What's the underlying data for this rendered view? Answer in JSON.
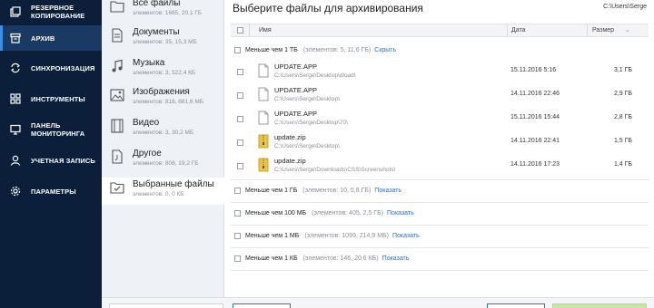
{
  "nav": {
    "items": [
      {
        "label": "РЕЗЕРВНОЕ КОПИРОВАНИЕ",
        "icon": "backup-icon"
      },
      {
        "label": "АРХИВ",
        "icon": "archive-icon",
        "active": true
      },
      {
        "label": "СИНХРОНИЗАЦИЯ",
        "icon": "sync-icon"
      },
      {
        "label": "ИНСТРУМЕНТЫ",
        "icon": "tools-icon"
      },
      {
        "label": "ПАНЕЛЬ МОНИТОРИНГА",
        "icon": "dashboard-icon"
      },
      {
        "label": "УЧЕТНАЯ ЗАПИСЬ",
        "icon": "account-icon"
      },
      {
        "label": "ПАРАМЕТРЫ",
        "icon": "settings-icon"
      }
    ]
  },
  "categories": [
    {
      "name": "Все файлы",
      "sub": "элементов: 1665, 20,1 ГБ",
      "icon": "folder-icon"
    },
    {
      "name": "Документы",
      "sub": "элементов: 35, 15,3 МБ",
      "icon": "document-icon"
    },
    {
      "name": "Музыка",
      "sub": "элементов: 3, 522,4 КБ",
      "icon": "music-icon"
    },
    {
      "name": "Изображения",
      "sub": "элементов: 816, 881,6 МБ",
      "icon": "image-icon"
    },
    {
      "name": "Видео",
      "sub": "элементов: 3, 30,2 МБ",
      "icon": "video-icon"
    },
    {
      "name": "Другое",
      "sub": "элементов: 808, 19,2 ГБ",
      "icon": "other-file-icon"
    },
    {
      "name": "Выбранные файлы",
      "sub": "элементов: 0, 0 КБ",
      "icon": "selected-files-icon",
      "active": true
    }
  ],
  "main": {
    "title": "Выберите файлы для архивирования",
    "path": "C:\\Users\\Serge",
    "columns": {
      "name": "Имя",
      "date": "Дата",
      "size": "Размер"
    },
    "groups": [
      {
        "name": "Меньше чем 1 ТБ",
        "sub": "(элементов: 5, 11,6 ГБ)",
        "link": "Скрыть",
        "files": [
          {
            "name": "UPDATE.APP",
            "path": "C:\\Users\\Serge\\Desktop\\dload\\",
            "date": "15.11.2016 5:16",
            "size": "3,1 ГБ",
            "type": "file"
          },
          {
            "name": "UPDATE.APP",
            "path": "C:\\Users\\Serge\\Desktop\\",
            "date": "14.11.2016 22:46",
            "size": "2,9 ГБ",
            "type": "file"
          },
          {
            "name": "UPDATE.APP",
            "path": "C:\\Users\\Serge\\Desktop\\70\\",
            "date": "15.11.2016 15:44",
            "size": "2,8 ГБ",
            "type": "file"
          },
          {
            "name": "update.zip",
            "path": "C:\\Users\\Serge\\Desktop\\",
            "date": "14.11.2016 22:41",
            "size": "1,5 ГБ",
            "type": "zip"
          },
          {
            "name": "update.zip",
            "path": "C:\\Users\\Serge\\Downloads\\CSS\\Screenshots\\",
            "date": "14.11.2016 17:23",
            "size": "1,4 ГБ",
            "type": "zip"
          }
        ]
      },
      {
        "name": "Меньше чем 1 ГБ",
        "sub": "(элементов: 10, 5,8 ГБ)",
        "link": "Показать"
      },
      {
        "name": "Меньше чем 100 МБ",
        "sub": "(элементов: 405, 2,5 ГБ)",
        "link": "Показать"
      },
      {
        "name": "Меньше чем 1 МБ",
        "sub": "(элементов: 1099, 214,9 МБ)",
        "link": "Показать"
      },
      {
        "name": "Меньше чем 1 КБ",
        "sub": "(элементов: 146, 20,6 КБ)",
        "link": "Показать"
      }
    ]
  },
  "colors": {
    "nav_bg": "#0b1f3a",
    "nav_active": "#1b3a63",
    "accent": "#2b6fd1",
    "zip": "#e8c547"
  }
}
